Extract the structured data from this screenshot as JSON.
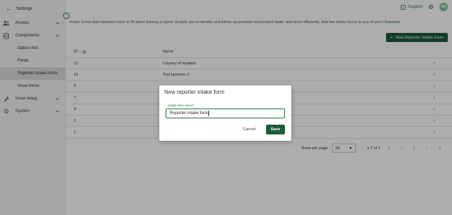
{
  "sidebar": {
    "header": "Settings",
    "items": [
      {
        "label": "Access",
        "icon": "users-icon",
        "expanded": false
      },
      {
        "label": "Components",
        "icon": "database-icon",
        "expanded": true,
        "children": [
          {
            "label": "Option lists",
            "active": false
          },
          {
            "label": "Fields",
            "active": false
          },
          {
            "label": "Reporter intake forms",
            "active": true
          },
          {
            "label": "Issue forms",
            "active": false
          }
        ]
      },
      {
        "label": "Issue setup",
        "icon": "wrench-icon",
        "expanded": false
      },
      {
        "label": "System",
        "icon": "gear-icon",
        "expanded": false
      }
    ]
  },
  "topbar": {
    "support_label": "Support",
    "avatar_initials": "KD"
  },
  "main": {
    "intro_text": "Intake forms that reporters have to fill when leaving a report. Enable you to identify and follow-up possible misconduct faster and more efficiently. Add the intake forms to any of your",
    "intro_link": "Channels",
    "intro_end": ".",
    "new_button_label": "New Reporter Intake Form",
    "table": {
      "headers": {
        "id": "ID",
        "sort_badge": "1",
        "name": "Name"
      },
      "rows": [
        {
          "id": "11",
          "name": "Country of incident"
        },
        {
          "id": "10",
          "name": "Test factories 2"
        },
        {
          "id": "9",
          "name": ""
        },
        {
          "id": "7",
          "name": ""
        },
        {
          "id": "3",
          "name": ""
        },
        {
          "id": "2",
          "name": ""
        },
        {
          "id": "1",
          "name": ""
        }
      ]
    },
    "pagination": {
      "rows_per_page_label": "Rows per page",
      "rows_per_page_value": "50",
      "range": "1-7 of 7",
      "page": "1"
    }
  },
  "dialog": {
    "title": "New reporter intake form",
    "field_label": "Intake form name*",
    "field_value": "Reporter intake form",
    "cancel_label": "Cancel",
    "save_label": "Save"
  },
  "colors": {
    "accent": "#1e6e3c",
    "primary_button": "#1e5b3a",
    "avatar": "#7bc59a",
    "overlay": "rgba(0,0,0,0.32)"
  }
}
